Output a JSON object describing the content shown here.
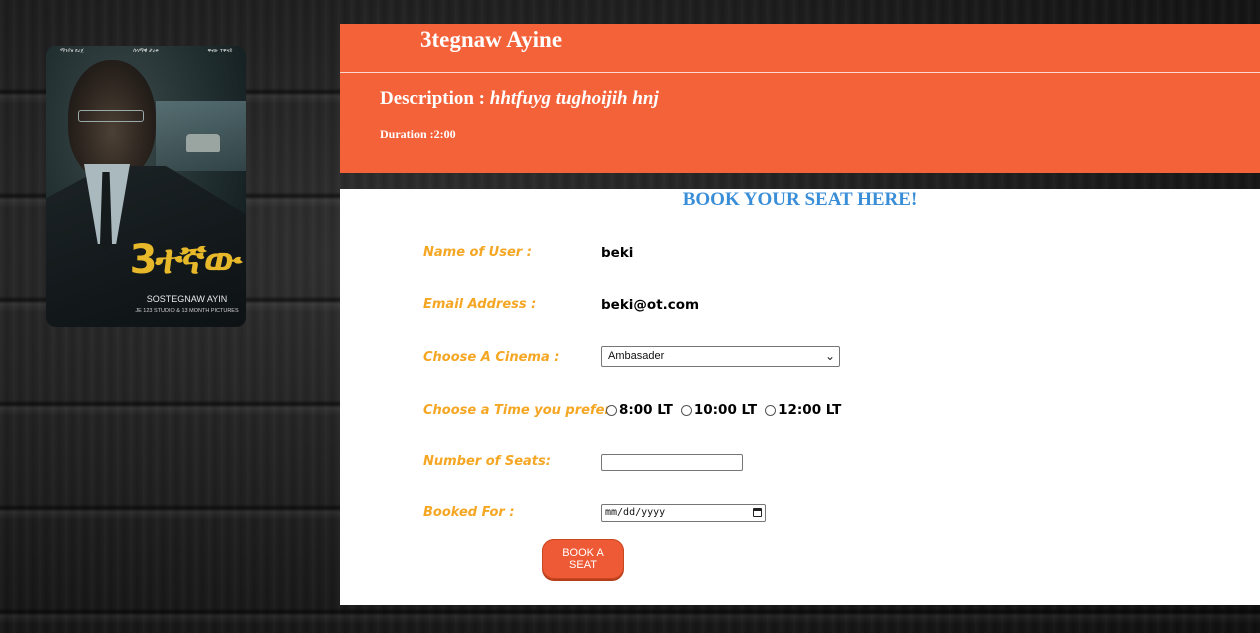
{
  "poster": {
    "credits": [
      "ማንያዘ ደረጀ",
      "ሰላማዊ ታረቀ",
      "ዋናው ተዋናይ"
    ],
    "big_title": "3ተኛው",
    "latin_title": "SOSTEGNAW AYIN",
    "studio_credit": "JE 123 STUDIO & 13 MONTH PICTURES"
  },
  "header": {
    "movie_title": "3tegnaw Ayine",
    "description_label": "Description : ",
    "description_value": "hhtfuyg tughoijih hnj",
    "duration": "Duration :2:00"
  },
  "booking": {
    "heading": "BOOK YOUR SEAT HERE!",
    "name_label": "Name of User :",
    "name_value": "beki",
    "email_label": "Email Address :",
    "email_value": "beki@ot.com",
    "cinema_label": "Choose A Cinema :",
    "cinema_selected": "Ambasader",
    "time_label": "Choose a Time you prefer:",
    "time_options": [
      "8:00 LT",
      "10:00 LT",
      "12:00 LT"
    ],
    "seats_label": "Number of Seats:",
    "booked_for_label": "Booked For :",
    "date_placeholder": "mm/dd/yyyy",
    "submit_label": "BOOK A SEAT"
  },
  "colors": {
    "header_bg": "#f4623a",
    "label": "#f5a623",
    "heading": "#3a8ed8",
    "button": "#ee5a35"
  }
}
